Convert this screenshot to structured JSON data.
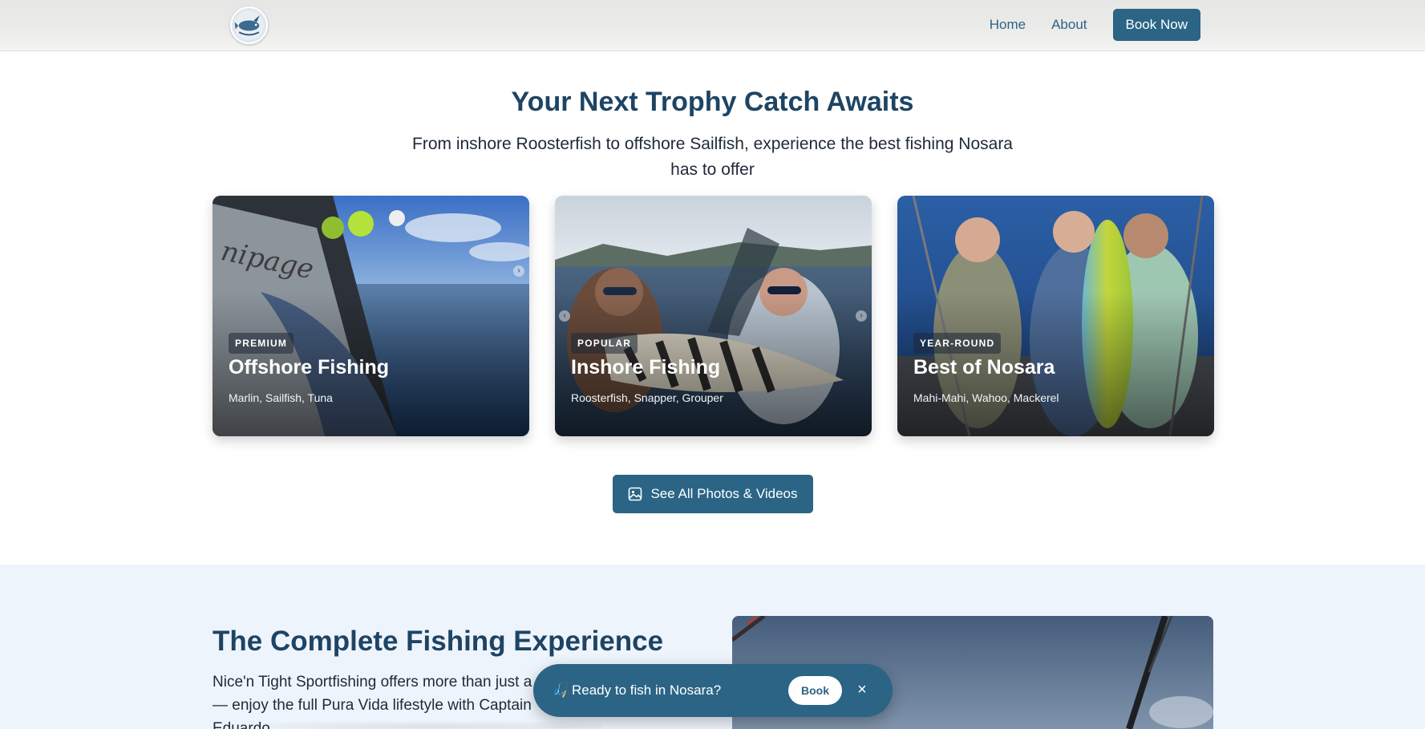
{
  "header": {
    "nav": {
      "home": "Home",
      "about": "About",
      "book_now": "Book Now"
    }
  },
  "trophy": {
    "title": "Your Next Trophy Catch Awaits",
    "subtitle": "From inshore Roosterfish to offshore Sailfish, experience the best fishing Nosara has to offer",
    "cards": [
      {
        "badge": "PREMIUM",
        "title": "Offshore Fishing",
        "desc": "Marlin, Sailfish, Tuna"
      },
      {
        "badge": "POPULAR",
        "title": "Inshore Fishing",
        "desc": "Roosterfish, Snapper, Grouper"
      },
      {
        "badge": "YEAR-ROUND",
        "title": "Best of Nosara",
        "desc": "Mahi-Mahi, Wahoo, Mackerel"
      }
    ],
    "photos_button": "See All Photos & Videos"
  },
  "experience": {
    "title": "The Complete Fishing Experience",
    "text": "Nice'n Tight Sportfishing offers more than just a charter — enjoy the full Pura Vida lifestyle with Captain Eduardo."
  },
  "floatbar": {
    "icon": "🎣",
    "text": "Ready to fish in Nosara?",
    "book": "Book",
    "close": "×"
  },
  "colors": {
    "primary": "#2b6485",
    "heading": "#1e4464",
    "nav_link": "#2e6388",
    "section_bg": "#eef4fc"
  },
  "icons": [
    "logo",
    "image-icon",
    "close-icon",
    "fishing-pole-icon",
    "chevron-left-icon",
    "chevron-right-icon"
  ]
}
